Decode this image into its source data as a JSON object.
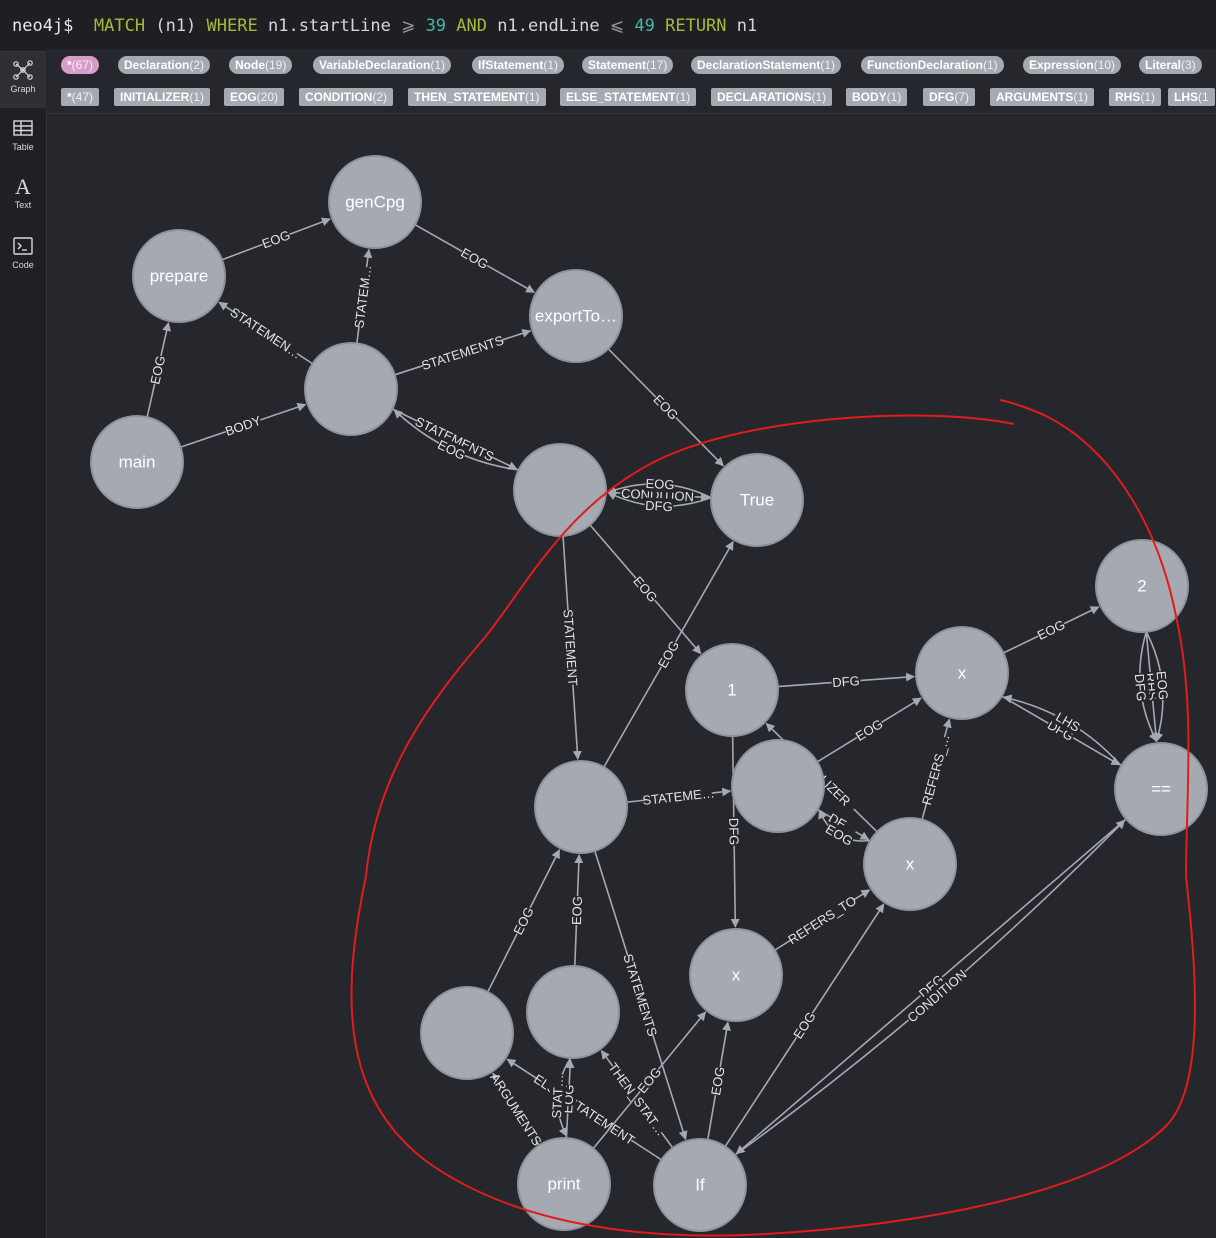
{
  "query": {
    "prompt": "neo4j$",
    "kw_match": "MATCH",
    "paren": "(n1)",
    "kw_where": "WHERE",
    "field1": "n1.startLine",
    "op1": "⩾",
    "num1": "39",
    "kw_and": "AND",
    "field2": "n1.endLine",
    "op2": "⩽",
    "num2": "49",
    "kw_return": "RETURN",
    "ret": "n1"
  },
  "sidebar": {
    "items": [
      {
        "label": "Graph",
        "icon": "graph-icon"
      },
      {
        "label": "Table",
        "icon": "table-icon"
      },
      {
        "label": "Text",
        "icon": "text-icon"
      },
      {
        "label": "Code",
        "icon": "code-icon"
      }
    ]
  },
  "labels_row": [
    {
      "name": "*",
      "count": "(67)",
      "color": "#d99cc9"
    },
    {
      "name": "Declaration",
      "count": "(2)"
    },
    {
      "name": "Node",
      "count": "(19)"
    },
    {
      "name": "VariableDeclaration",
      "count": "(1)"
    },
    {
      "name": "IfStatement",
      "count": "(1)"
    },
    {
      "name": "Statement",
      "count": "(17)"
    },
    {
      "name": "DeclarationStatement",
      "count": "(1)"
    },
    {
      "name": "FunctionDeclaration",
      "count": "(1)"
    },
    {
      "name": "Expression",
      "count": "(10)"
    },
    {
      "name": "Literal",
      "count": "(3)"
    }
  ],
  "rels_row": [
    {
      "name": "*",
      "count": "(47)"
    },
    {
      "name": "INITIALIZER",
      "count": "(1)"
    },
    {
      "name": "EOG",
      "count": "(20)"
    },
    {
      "name": "CONDITION",
      "count": "(2)"
    },
    {
      "name": "THEN_STATEMENT",
      "count": "(1)"
    },
    {
      "name": "ELSE_STATEMENT",
      "count": "(1)"
    },
    {
      "name": "DECLARATIONS",
      "count": "(1)"
    },
    {
      "name": "BODY",
      "count": "(1)"
    },
    {
      "name": "DFG",
      "count": "(7)"
    },
    {
      "name": "ARGUMENTS",
      "count": "(1)"
    },
    {
      "name": "RHS",
      "count": "(1)"
    },
    {
      "name": "LHS",
      "count": "(1"
    }
  ],
  "graph": {
    "nodes": [
      {
        "id": "genCpg",
        "caption": "genCpg"
      },
      {
        "id": "prepare",
        "caption": "prepare"
      },
      {
        "id": "block",
        "caption": ""
      },
      {
        "id": "exportTo",
        "caption": "exportTo…"
      },
      {
        "id": "main",
        "caption": "main"
      },
      {
        "id": "cond",
        "caption": ""
      },
      {
        "id": "True",
        "caption": "True"
      },
      {
        "id": "two",
        "caption": "2"
      },
      {
        "id": "one",
        "caption": "1"
      },
      {
        "id": "x1",
        "caption": "x"
      },
      {
        "id": "stmt",
        "caption": ""
      },
      {
        "id": "decl",
        "caption": ""
      },
      {
        "id": "eq",
        "caption": "=="
      },
      {
        "id": "x2",
        "caption": "x"
      },
      {
        "id": "x3",
        "caption": "x"
      },
      {
        "id": "b1",
        "caption": ""
      },
      {
        "id": "b2",
        "caption": ""
      },
      {
        "id": "print",
        "caption": "print"
      },
      {
        "id": "If",
        "caption": "If"
      }
    ],
    "edges": [
      {
        "from": "prepare",
        "to": "genCpg",
        "label": "EOG"
      },
      {
        "from": "genCpg",
        "to": "exportTo",
        "label": "EOG"
      },
      {
        "from": "block",
        "to": "prepare",
        "label": "STATEMEN…"
      },
      {
        "from": "block",
        "to": "genCpg",
        "label": "STATEM…"
      },
      {
        "from": "block",
        "to": "exportTo",
        "label": "STATEMENTS"
      },
      {
        "from": "block",
        "to": "cond",
        "label": "STATEMENTS"
      },
      {
        "from": "main",
        "to": "prepare",
        "label": "EOG"
      },
      {
        "from": "main",
        "to": "block",
        "label": "BODY"
      },
      {
        "from": "cond",
        "to": "block",
        "label": "EOG"
      },
      {
        "from": "exportTo",
        "to": "True",
        "label": "EOG"
      },
      {
        "from": "cond",
        "to": "True",
        "label": "CONDITION"
      },
      {
        "from": "True",
        "to": "cond",
        "label": "EOG"
      },
      {
        "from": "True",
        "to": "cond",
        "label": "DFG"
      },
      {
        "from": "cond",
        "to": "one",
        "label": "EOG"
      },
      {
        "from": "cond",
        "to": "stmt",
        "label": "STATEMENT"
      },
      {
        "from": "stmt",
        "to": "True",
        "label": "EOG"
      },
      {
        "from": "one",
        "to": "x1",
        "label": "DFG"
      },
      {
        "from": "x1",
        "to": "two",
        "label": "EOG"
      },
      {
        "from": "x1",
        "to": "eq",
        "label": "DFG"
      },
      {
        "from": "eq",
        "to": "x1",
        "label": "LHS"
      },
      {
        "from": "two",
        "to": "eq",
        "label": "RHS"
      },
      {
        "from": "two",
        "to": "eq",
        "label": "EOG"
      },
      {
        "from": "two",
        "to": "eq",
        "label": "DFG"
      },
      {
        "from": "stmt",
        "to": "decl",
        "label": "STATEME…"
      },
      {
        "from": "x2",
        "to": "one",
        "label": "INITIALIZER"
      },
      {
        "from": "decl",
        "to": "x1",
        "label": "EOG"
      },
      {
        "from": "x2",
        "to": "x1",
        "label": "REFERS_…"
      },
      {
        "from": "decl",
        "to": "x2",
        "label": "DE…"
      },
      {
        "from": "x2",
        "to": "decl",
        "label": "EOG"
      },
      {
        "from": "one",
        "to": "x3",
        "label": "DFG"
      },
      {
        "from": "x3",
        "to": "x2",
        "label": "REFERS_TO"
      },
      {
        "from": "If",
        "to": "x2",
        "label": "EOG"
      },
      {
        "from": "eq",
        "to": "If",
        "label": "DFG"
      },
      {
        "from": "If",
        "to": "eq",
        "label": "CONDITION"
      },
      {
        "from": "b1",
        "to": "stmt",
        "label": "EOG"
      },
      {
        "from": "b2",
        "to": "stmt",
        "label": "EOG"
      },
      {
        "from": "stmt",
        "to": "If",
        "label": "STATEMENTS"
      },
      {
        "from": "If",
        "to": "b2",
        "label": "THEN_STAT…"
      },
      {
        "from": "If",
        "to": "b1",
        "label": "ELSE_STATEMENT"
      },
      {
        "from": "print",
        "to": "x3",
        "label": "EOG"
      },
      {
        "from": "print",
        "to": "b2",
        "label": "EOG"
      },
      {
        "from": "b2",
        "to": "print",
        "label": "STAT…"
      },
      {
        "from": "If",
        "to": "x3",
        "label": "EOG"
      },
      {
        "from": "print",
        "to": "b1",
        "label": "ARGUMENTS"
      }
    ]
  }
}
